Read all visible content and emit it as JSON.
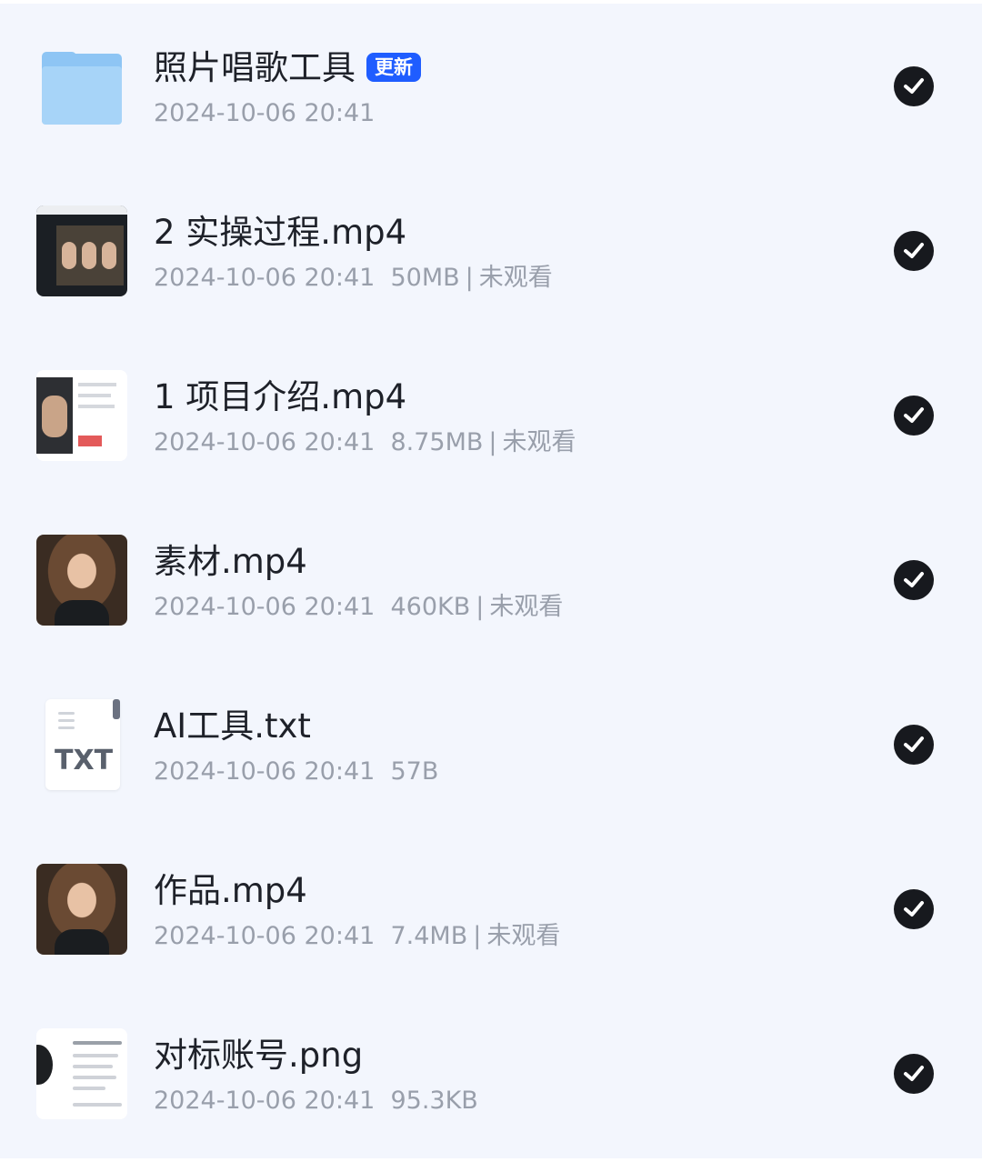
{
  "colors": {
    "background": "#f3f6fd",
    "title": "#1e2129",
    "meta": "#999fab",
    "badge": "#1f5dff",
    "check": "#17191e"
  },
  "files": [
    {
      "name": "照片唱歌工具",
      "kind": "folder",
      "icon": "folder-icon",
      "badge": "更新",
      "date": "2024-10-06 20:41",
      "size": "",
      "status": "",
      "selected": true
    },
    {
      "name": "2 实操过程.mp4",
      "kind": "video",
      "icon": "video-thumbnail",
      "date": "2024-10-06 20:41",
      "size": "50MB",
      "status": "未观看",
      "selected": true
    },
    {
      "name": "1 项目介绍.mp4",
      "kind": "video",
      "icon": "video-thumbnail",
      "date": "2024-10-06 20:41",
      "size": "8.75MB",
      "status": "未观看",
      "selected": true
    },
    {
      "name": "素材.mp4",
      "kind": "video",
      "icon": "video-thumbnail",
      "date": "2024-10-06 20:41",
      "size": "460KB",
      "status": "未观看",
      "selected": true
    },
    {
      "name": "AI工具.txt",
      "kind": "text",
      "icon": "txt-file-icon",
      "icon_label": "TXT",
      "date": "2024-10-06 20:41",
      "size": "57B",
      "status": "",
      "selected": true
    },
    {
      "name": "作品.mp4",
      "kind": "video",
      "icon": "video-thumbnail",
      "date": "2024-10-06 20:41",
      "size": "7.4MB",
      "status": "未观看",
      "selected": true
    },
    {
      "name": "对标账号.png",
      "kind": "image",
      "icon": "image-thumbnail",
      "date": "2024-10-06 20:41",
      "size": "95.3KB",
      "status": "",
      "selected": true
    }
  ]
}
